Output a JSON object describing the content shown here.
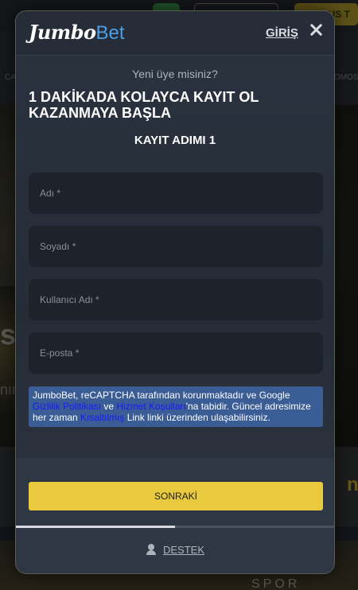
{
  "background": {
    "bonus_label": "BONUS T",
    "nav_left": "CA",
    "nav_right": "OMOS",
    "hero_text": "si",
    "hero_text2": "nır",
    "mid_text": "n",
    "bottom_text": "SPOR"
  },
  "modal": {
    "logo": {
      "part1": "Jumbo",
      "part2": "Bet"
    },
    "login_link": "GİRİŞ",
    "subheading": "Yeni üye misiniz?",
    "headline": "1 DAKİKADA KOLAYCA KAYIT OL KAZANMAYA BAŞLA",
    "step_label": "KAYIT ADIMI 1",
    "fields": {
      "first_name": {
        "placeholder": "Adı *",
        "value": ""
      },
      "last_name": {
        "placeholder": "Soyadı *",
        "value": ""
      },
      "username": {
        "placeholder": "Kullanıcı Adı *",
        "value": ""
      },
      "email": {
        "placeholder": "E-posta *",
        "value": ""
      }
    },
    "notice": {
      "text1": "JumboBet, reCAPTCHA tarafından korunmaktadır ve Google ",
      "privacy_link": "Gizlilik Politikası",
      "text2": " ve ",
      "terms_link": "Hizmet Koşulları",
      "text3": "'na tabidir. Güncel adresimize her zaman ",
      "short_link": "Kısaltılmış",
      "text4": " Link linki üzerinden ulaşabilirsiniz."
    },
    "next_button": "SONRAKİ",
    "progress": 0.5,
    "support_label": "DESTEK"
  },
  "colors": {
    "accent_yellow": "#e9c93d",
    "logo_blue": "#4a9fe6",
    "notice_bg": "#3a5d95",
    "link_blue": "#1919ff"
  },
  "icons": {
    "close": "close-icon",
    "support": "support-agent-icon"
  }
}
